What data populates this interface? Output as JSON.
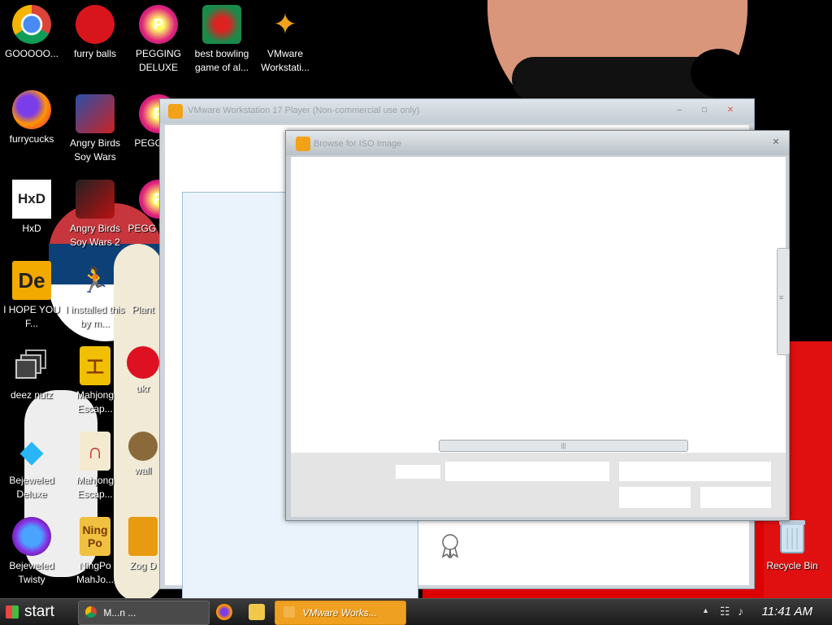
{
  "desktop": {
    "icons": [
      {
        "label": "GOOOOO...",
        "icon": "chrome-icon"
      },
      {
        "label": "furry balls",
        "icon": "red-fuzzball-icon"
      },
      {
        "label": "PEGGING DELUXE",
        "icon": "pegging-p-icon"
      },
      {
        "label": "best bowling game of al...",
        "icon": "bowling-santa-icon"
      },
      {
        "label": "VMware Workstati...",
        "icon": "vmware-icon"
      },
      {
        "label": "furrycucks",
        "icon": "firefox-icon"
      },
      {
        "label": "Angry Birds Soy Wars",
        "icon": "angry-birds-icon"
      },
      {
        "label": "PEGG NIG",
        "icon": "pegging-p-icon"
      },
      {
        "label": "HxD",
        "icon": "hxd-icon"
      },
      {
        "label": "Angry Birds Soy Wars 2",
        "icon": "angry-birds-2-icon"
      },
      {
        "label": "PEGG WARG",
        "icon": "pegging-p-icon"
      },
      {
        "label": "I HOPE YOU F...",
        "icon": "de-icon"
      },
      {
        "label": "I installed this by m...",
        "icon": "runner-icon"
      },
      {
        "label": "Plant",
        "icon": "plant-icon"
      },
      {
        "label": "deez nutz",
        "icon": "windows-stack-icon"
      },
      {
        "label": "Mahjong Escap...",
        "icon": "mahjong-icon"
      },
      {
        "label": "ukr",
        "icon": "red-circle-icon"
      },
      {
        "label": "Bejeweled Deluxe",
        "icon": "bejeweled-gem-icon"
      },
      {
        "label": "Mahjong Escap...",
        "icon": "mahjong-gate-icon"
      },
      {
        "label": "wall",
        "icon": "wall-icon"
      },
      {
        "label": "Bejeweled Twisty",
        "icon": "bejeweled-twist-icon"
      },
      {
        "label": "NingPo MahJo...",
        "icon": "ningpo-icon"
      },
      {
        "label": "Zog D",
        "icon": "zog-icon"
      },
      {
        "label": "Recycle Bin",
        "icon": "recycle-bin-icon"
      }
    ]
  },
  "vmware_window": {
    "title": "VMware Workstation 17 Player (Non-commercial use only)",
    "minimize": "–",
    "maximize": "□",
    "close": "✕"
  },
  "browse_dialog": {
    "title": "Browse for ISO Image",
    "close": "✕",
    "hscroll_grip": "|||",
    "vscroll_grip": "≡"
  },
  "taskbar": {
    "start_label": "start",
    "chrome_task": "M...n ...",
    "vmware_task": "VMware Works...",
    "clock": "11:41 AM",
    "tray_arrow": "▲",
    "tray_network": "☷",
    "tray_volume": "♪"
  },
  "colors": {
    "vmware_accent": "#f0a020",
    "taskbar": "#2a2a2a"
  }
}
